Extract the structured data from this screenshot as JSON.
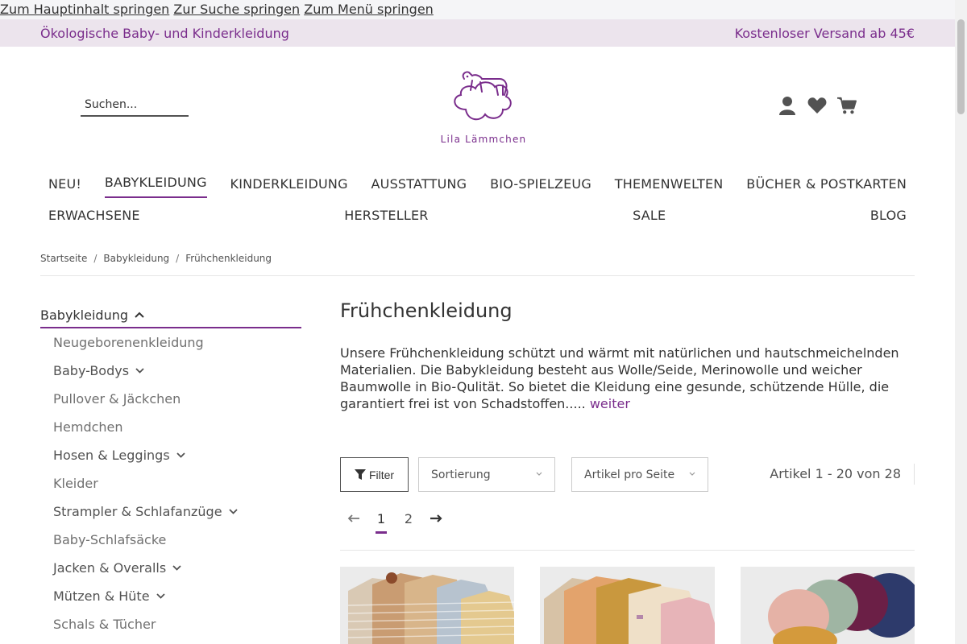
{
  "skip_links": [
    "Zum Hauptinhalt springen",
    "Zur Suche springen",
    "Zum Menü springen"
  ],
  "topbar": {
    "left": "Ökologische Baby- und Kinderkleidung",
    "right": "Kostenloser Versand ab 45€"
  },
  "header": {
    "search_placeholder": "Suchen...",
    "brand": "Lila Lämmchen",
    "icons": [
      "user-icon",
      "heart-icon",
      "cart-icon"
    ]
  },
  "nav": {
    "row1": [
      "NEU!",
      "BABYKLEIDUNG",
      "KINDERKLEIDUNG",
      "AUSSTATTUNG",
      "BIO-SPIELZEUG",
      "THEMENWELTEN",
      "BÜCHER & POSTKARTEN"
    ],
    "row2": [
      "ERWACHSENE",
      "HERSTELLER",
      "SALE",
      "BLOG"
    ],
    "active": "BABYKLEIDUNG"
  },
  "breadcrumb": [
    "Startseite",
    "Babykleidung",
    "Frühchenkleidung"
  ],
  "sidebar": {
    "heading": "Babykleidung",
    "items": [
      {
        "label": "Neugeborenenkleidung",
        "children": false
      },
      {
        "label": "Baby-Bodys",
        "children": true
      },
      {
        "label": "Pullover & Jäckchen",
        "children": false
      },
      {
        "label": "Hemdchen",
        "children": false
      },
      {
        "label": "Hosen & Leggings",
        "children": true
      },
      {
        "label": "Kleider",
        "children": false
      },
      {
        "label": "Strampler & Schlafanzüge",
        "children": true
      },
      {
        "label": "Baby-Schlafsäcke",
        "children": false
      },
      {
        "label": "Jacken & Overalls",
        "children": true
      },
      {
        "label": "Mützen & Hüte",
        "children": true
      },
      {
        "label": "Schals & Tücher",
        "children": false
      }
    ]
  },
  "content": {
    "title": "Frühchenkleidung",
    "description": "Unsere Frühchenkleidung schützt und wärmt mit natürlichen und hautschmeichelnden Materialien. Die Babykleidung besteht aus Wolle/Seide, Merinowolle und weicher Baumwolle in Bio-Qulität. So bietet die Kleidung eine gesunde, schützende Hülle, die garantiert frei ist von Schadstoffen.....",
    "more_link": "weiter"
  },
  "toolbar": {
    "filter_label": "Filter",
    "sort_label": "Sortierung",
    "per_page_label": "Artikel pro Seite",
    "count_text": "Artikel 1 - 20 von 28"
  },
  "pagination": {
    "pages": [
      "1",
      "2"
    ],
    "current": "1"
  },
  "colors": {
    "accent": "#7a2d8c",
    "topbar_bg": "#ece4ed"
  }
}
